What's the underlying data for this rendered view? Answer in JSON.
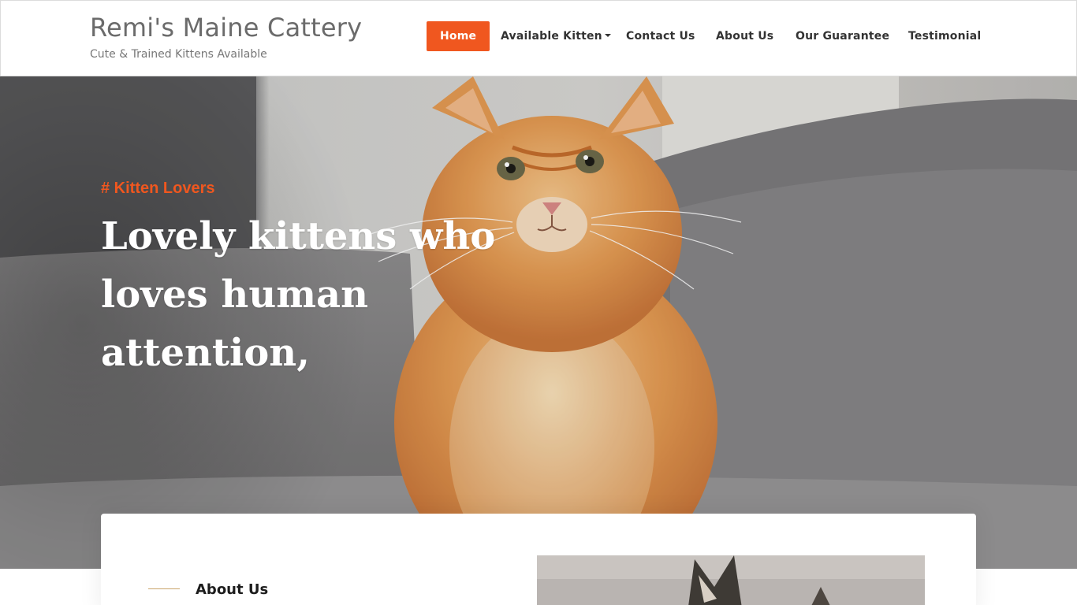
{
  "header": {
    "site_title": "Remi's Maine Cattery",
    "tagline": "Cute & Trained Kittens Available"
  },
  "nav": {
    "items": [
      {
        "label": "Home",
        "active": true
      },
      {
        "label": "Available Kitten",
        "dropdown": true
      },
      {
        "label": "Contact Us"
      },
      {
        "label": "About Us"
      },
      {
        "label": "Our Guarantee"
      },
      {
        "label": "Testimonial"
      }
    ]
  },
  "hero": {
    "kicker": "# Kitten Lovers",
    "heading": "Lovely kittens who loves human attention,"
  },
  "about": {
    "label": "About Us"
  },
  "colors": {
    "accent": "#f0571f",
    "nav_text": "#333333",
    "title_text": "#6b6b6b",
    "gold_rule": "#c9a46a"
  },
  "icons": {
    "dropdown": "caret-down-icon"
  }
}
